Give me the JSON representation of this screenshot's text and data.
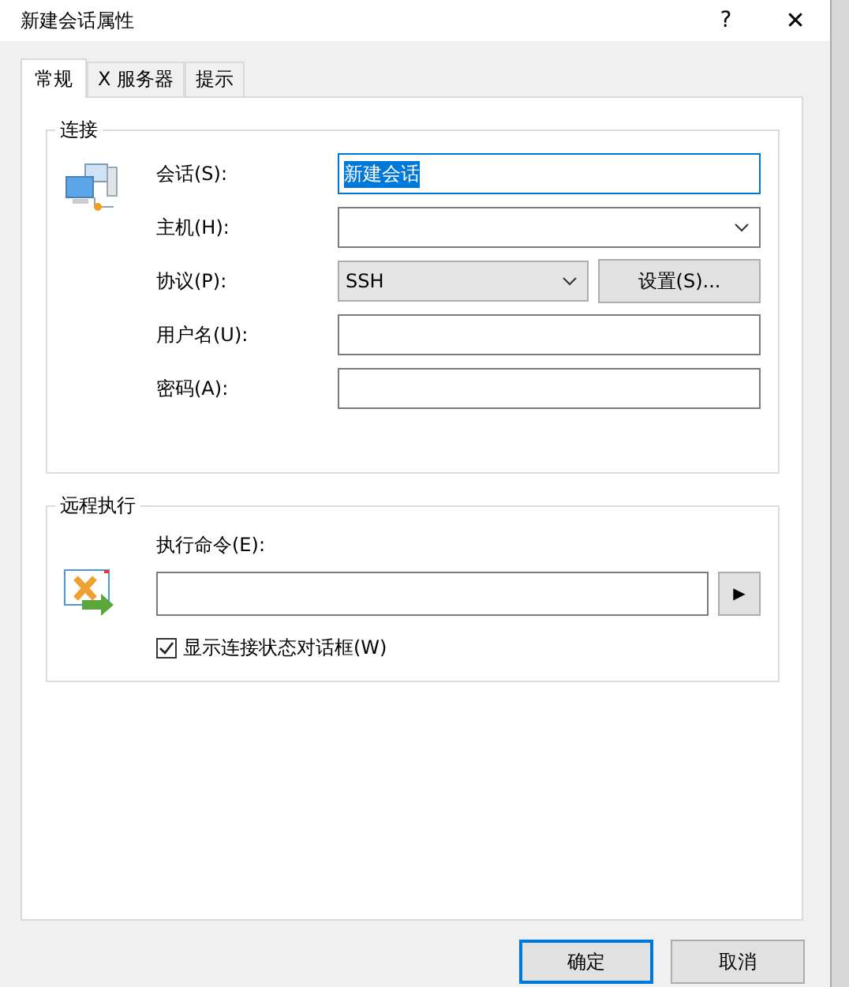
{
  "window": {
    "title": "新建会话属性",
    "help": "?",
    "close": "✕"
  },
  "tabs": [
    {
      "label": "常规",
      "selected": true
    },
    {
      "label": "X 服务器",
      "selected": false
    },
    {
      "label": "提示",
      "selected": false
    }
  ],
  "connection": {
    "title": "连接",
    "fields": [
      {
        "kind": "text",
        "label": "会话(S):",
        "value": "新建会话",
        "selected": true
      },
      {
        "kind": "combo",
        "label": "主机(H):"
      },
      {
        "kind": "combo",
        "label": "协议(P):",
        "value": "SSH",
        "button": "设置(S)..."
      },
      {
        "kind": "text",
        "label": "用户名(U):"
      },
      {
        "kind": "text",
        "label": "密码(A):"
      }
    ]
  },
  "remote": {
    "title": "远程执行",
    "command_label": "执行命令(E):",
    "run_button": "▶",
    "checkbox": {
      "label": "显示连接状态对话框(W)",
      "checked": true
    }
  },
  "buttons": [
    {
      "label": "确定",
      "default": true
    },
    {
      "label": "取消",
      "default": false
    }
  ]
}
